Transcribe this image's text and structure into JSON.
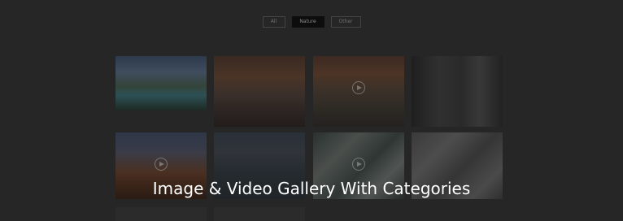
{
  "filters": {
    "all": "All",
    "nature": "Nature",
    "other": "Other",
    "active": "Nature"
  },
  "gallery": {
    "items": [
      {
        "type": "image",
        "icon": "landscape-image"
      },
      {
        "type": "image",
        "icon": "landscape-image"
      },
      {
        "type": "video",
        "icon": "play-icon"
      },
      {
        "type": "image",
        "icon": "landscape-image"
      },
      {
        "type": "video",
        "icon": "play-icon"
      },
      {
        "type": "image",
        "icon": "landscape-image"
      },
      {
        "type": "video",
        "icon": "play-icon"
      },
      {
        "type": "image",
        "icon": "landscape-image"
      },
      {
        "type": "image",
        "icon": "landscape-image"
      },
      {
        "type": "image",
        "icon": "landscape-image"
      }
    ]
  },
  "caption": "Image & Video Gallery With Categories",
  "colors": {
    "background": "#262626",
    "active_filter": "#0d0d0d",
    "caption": "#ffffff"
  }
}
